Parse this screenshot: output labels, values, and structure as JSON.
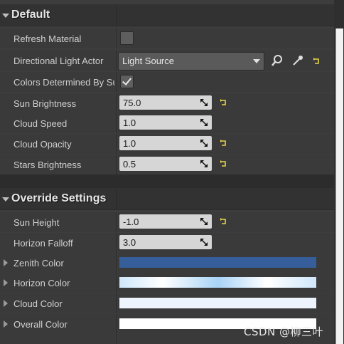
{
  "sections": {
    "default_title": "Default",
    "override_title": "Override Settings"
  },
  "default_rows": {
    "refresh_material": {
      "label": "Refresh Material",
      "checked": false
    },
    "directional_light_actor": {
      "label": "Directional Light Actor",
      "value": "Light Source"
    },
    "colors_determined": {
      "label": "Colors Determined By Sun",
      "checked": true
    },
    "sun_brightness": {
      "label": "Sun Brightness",
      "value": "75.0"
    },
    "cloud_speed": {
      "label": "Cloud Speed",
      "value": "1.0"
    },
    "cloud_opacity": {
      "label": "Cloud Opacity",
      "value": "1.0"
    },
    "stars_brightness": {
      "label": "Stars Brightness",
      "value": "0.5"
    }
  },
  "override_rows": {
    "sun_height": {
      "label": "Sun Height",
      "value": "-1.0"
    },
    "horizon_falloff": {
      "label": "Horizon Falloff",
      "value": "3.0"
    },
    "zenith_color": {
      "label": "Zenith Color",
      "color": "#365e9a"
    },
    "horizon_color": {
      "label": "Horizon Color",
      "color": "#cfe6fb"
    },
    "cloud_color": {
      "label": "Cloud Color",
      "color": "#eef4fd"
    },
    "overall_color": {
      "label": "Overall Color",
      "color": "#ffffff"
    }
  },
  "icons": {
    "browse": "search-icon",
    "picker": "eyedropper-icon",
    "reset": "reset-to-default-icon",
    "expand": "expand-arrow-icon"
  },
  "watermark": "CSDN @柳三叶"
}
